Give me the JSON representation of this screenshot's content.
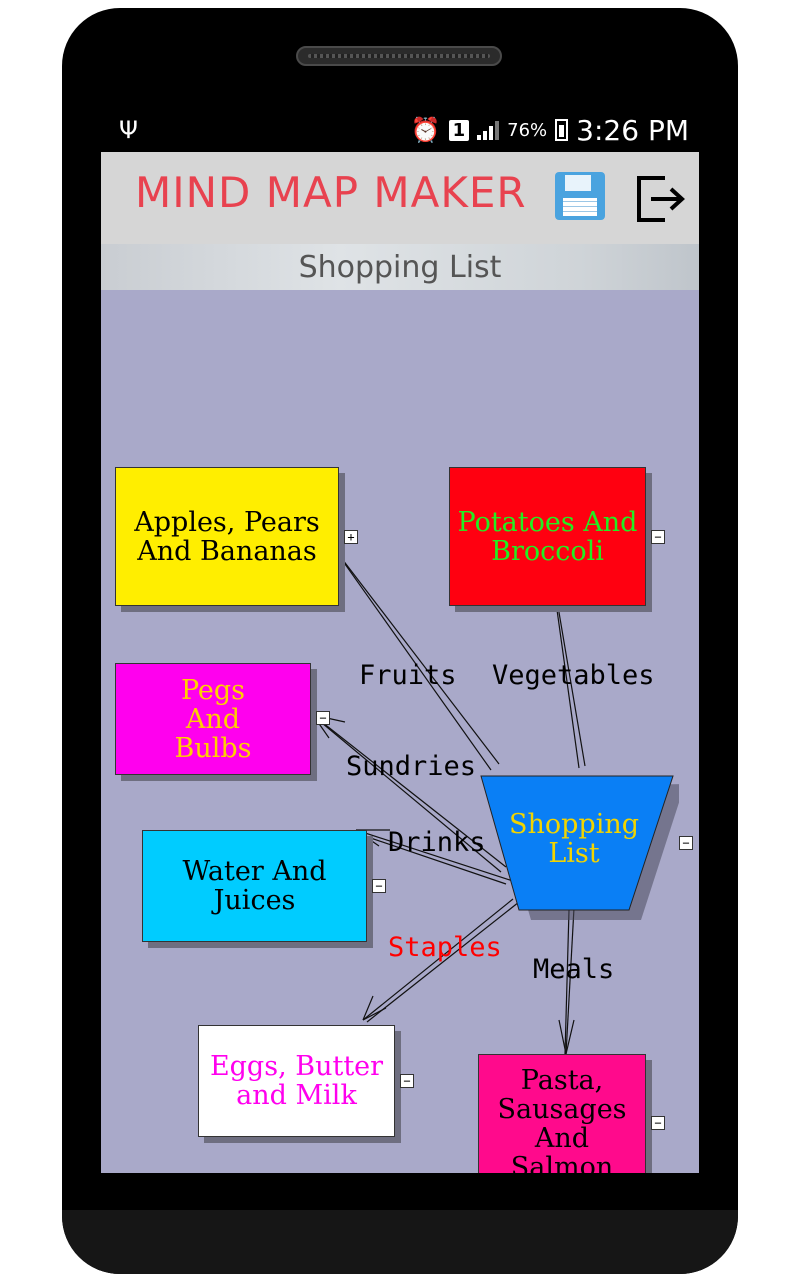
{
  "status_bar": {
    "battery": "76%",
    "time": "3:26 PM",
    "sim": "1"
  },
  "app": {
    "title": "MIND MAP MAKER",
    "map_title": "Shopping List"
  },
  "nodes": {
    "center": {
      "text": "Shopping List",
      "color": "#0a7ff5",
      "text_color": "#f2d400"
    },
    "fruits_node": {
      "text": "Apples, Pears And Bananas",
      "color": "#ffee00",
      "text_color": "#000000",
      "toggle": "+"
    },
    "vegetables_node": {
      "text": "Potatoes And Broccoli",
      "color": "#ff0010",
      "text_color": "#22ee22",
      "toggle": "−"
    },
    "sundries_node": {
      "text": "Pegs And Bulbs",
      "color": "#ff00ee",
      "text_color": "#ffd000",
      "toggle": "−"
    },
    "drinks_node": {
      "text": "Water And Juices",
      "color": "#00ccff",
      "text_color": "#000000",
      "toggle": "−"
    },
    "staples_node": {
      "text": "Eggs, Butter and Milk",
      "color": "#ffffff",
      "text_color": "#ff00ee",
      "toggle": "−"
    },
    "meals_node": {
      "text": "Pasta, Sausages And Salmon",
      "color": "#ff0a8c",
      "text_color": "#000000",
      "toggle": "−"
    },
    "center_toggle": "−"
  },
  "edges": {
    "fruits": "Fruits",
    "vegetables": "Vegetables",
    "sundries": "Sundries",
    "drinks": "Drinks",
    "staples": "Staples",
    "meals": "Meals"
  },
  "colors": {
    "canvas": "#a9a9c9",
    "title": "#e8424f",
    "staples_label": "#ff0000"
  }
}
